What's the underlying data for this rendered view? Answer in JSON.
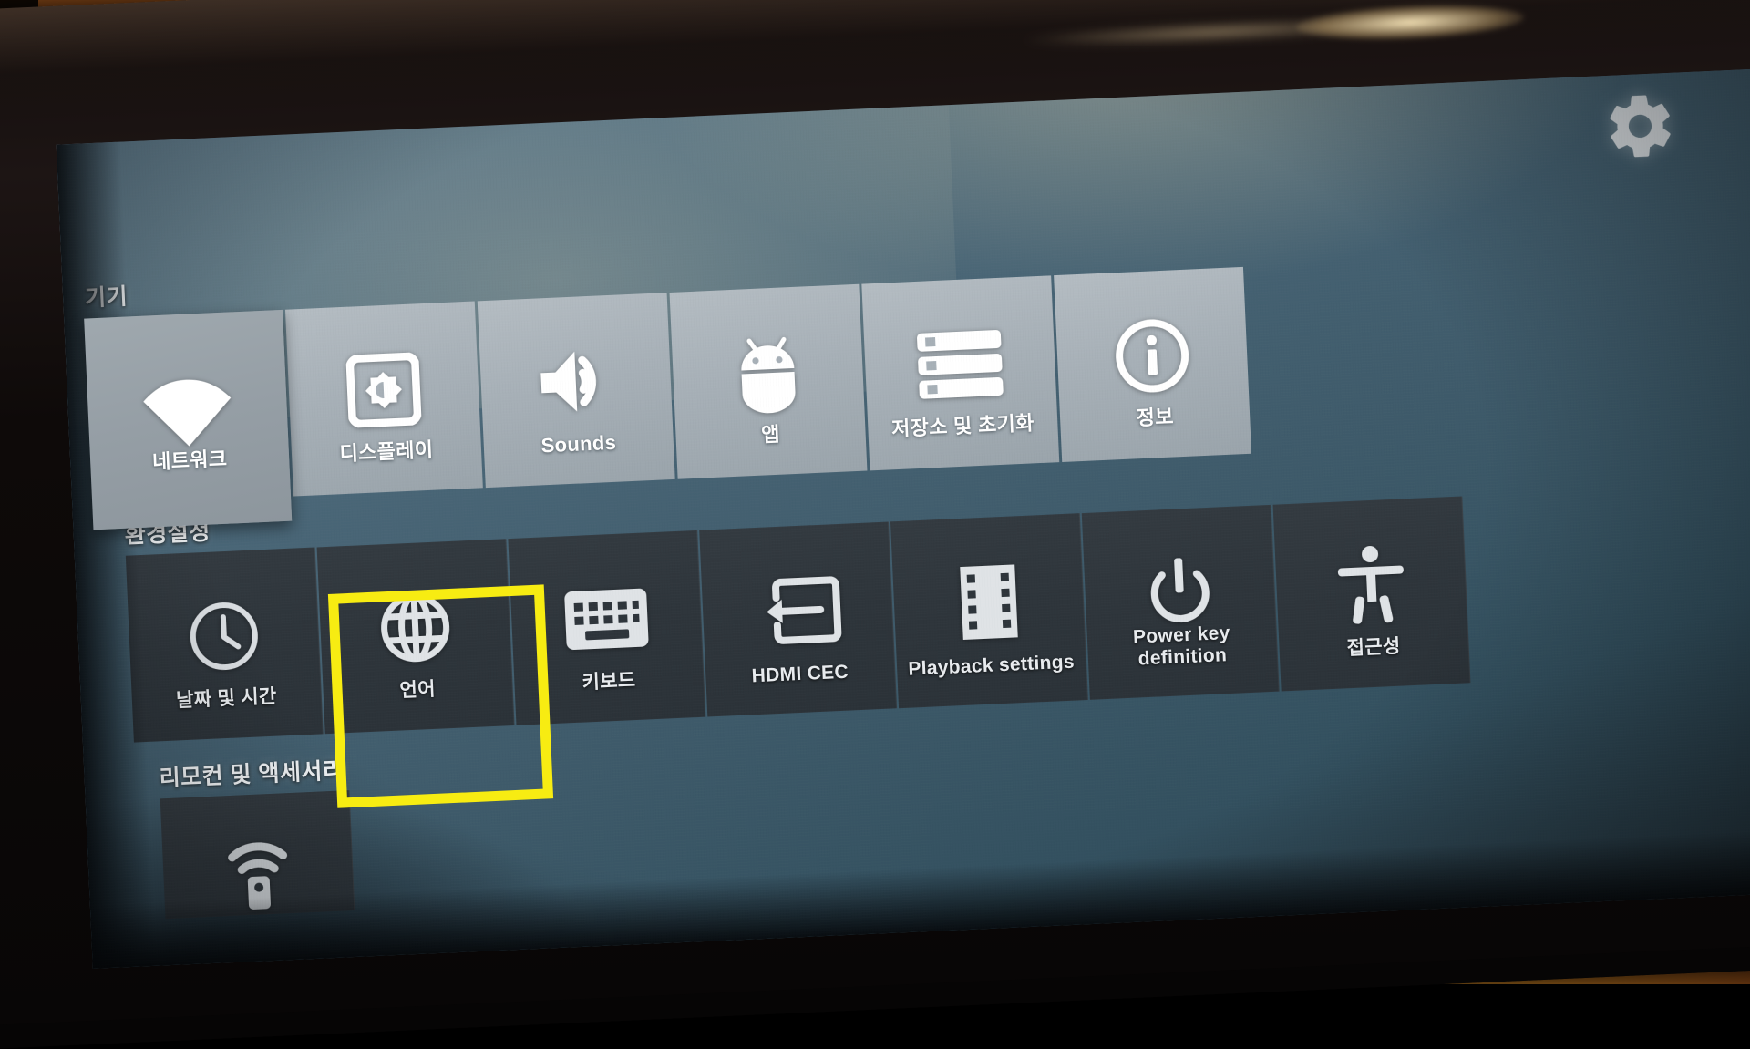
{
  "photo": {
    "scene": "android-tv-settings-on-television",
    "wall_color": "#c7822c",
    "bezel_color": "#120d0c"
  },
  "screen": {
    "background_color": "#3f5b6b",
    "gear_icon": "gear-icon"
  },
  "sections": [
    {
      "title": "기기",
      "style": "light",
      "tiles": [
        {
          "label": "네트워크",
          "icon": "wifi-icon",
          "focused": true
        },
        {
          "label": "디스플레이",
          "icon": "display-icon",
          "focused": false
        },
        {
          "label": "Sounds",
          "icon": "volume-icon",
          "focused": false
        },
        {
          "label": "앱",
          "icon": "android-icon",
          "focused": false
        },
        {
          "label": "저장소 및 초기화",
          "icon": "storage-icon",
          "focused": false
        },
        {
          "label": "정보",
          "icon": "info-icon",
          "focused": false
        }
      ]
    },
    {
      "title": "환경설정",
      "style": "dark",
      "tiles": [
        {
          "label": "날짜 및 시간",
          "icon": "clock-icon",
          "highlighted": false
        },
        {
          "label": "언어",
          "icon": "globe-icon",
          "highlighted": true
        },
        {
          "label": "키보드",
          "icon": "keyboard-icon",
          "highlighted": false
        },
        {
          "label": "HDMI CEC",
          "icon": "hdmi-cec-icon",
          "highlighted": false
        },
        {
          "label": "Playback settings",
          "icon": "film-strip-icon",
          "highlighted": false
        },
        {
          "label": "Power key definition",
          "icon": "power-icon",
          "highlighted": false
        },
        {
          "label": "접근성",
          "icon": "accessibility-icon",
          "highlighted": false
        }
      ]
    },
    {
      "title": "리모컨 및 액세서리",
      "style": "dark",
      "tiles": [
        {
          "label": "",
          "icon": "remote-control-icon",
          "highlighted": false
        }
      ]
    }
  ],
  "annotation": {
    "color": "#f7ec12",
    "target": "언어"
  }
}
